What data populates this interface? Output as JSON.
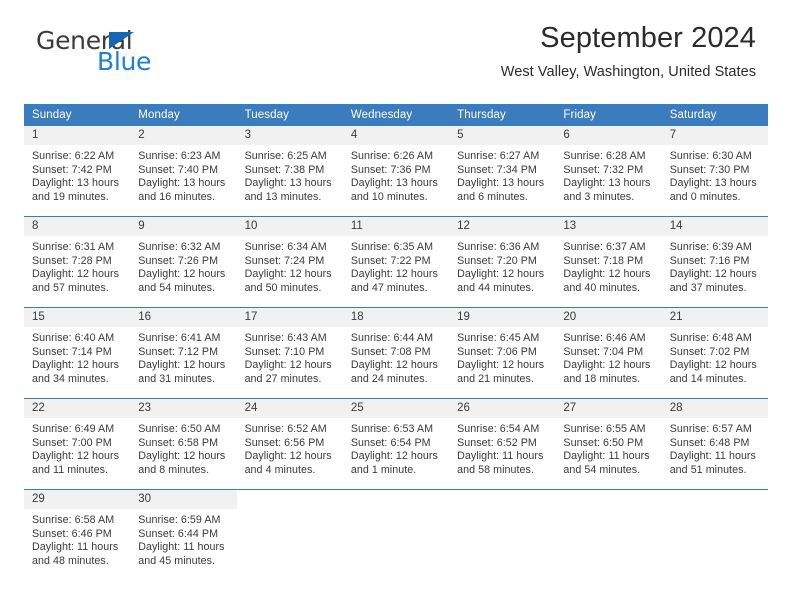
{
  "brand": {
    "word_top": "General",
    "word_bottom": "Blue",
    "triangle_icon": "blue-triangle-icon",
    "accent_color": "#1e7fd4"
  },
  "header": {
    "title": "September 2024",
    "subtitle": "West Valley, Washington, United States"
  },
  "theme": {
    "header_row_bg": "#3b7cbf",
    "daynum_bg": "#f1f1f1",
    "separator": "#3b7cbf",
    "text": "#3a3a3a"
  },
  "calendar": {
    "weekday_headers": [
      "Sunday",
      "Monday",
      "Tuesday",
      "Wednesday",
      "Thursday",
      "Friday",
      "Saturday"
    ],
    "weeks": [
      [
        {
          "day": "1",
          "sunrise": "Sunrise: 6:22 AM",
          "sunset": "Sunset: 7:42 PM",
          "daylight1": "Daylight: 13 hours",
          "daylight2": "and 19 minutes."
        },
        {
          "day": "2",
          "sunrise": "Sunrise: 6:23 AM",
          "sunset": "Sunset: 7:40 PM",
          "daylight1": "Daylight: 13 hours",
          "daylight2": "and 16 minutes."
        },
        {
          "day": "3",
          "sunrise": "Sunrise: 6:25 AM",
          "sunset": "Sunset: 7:38 PM",
          "daylight1": "Daylight: 13 hours",
          "daylight2": "and 13 minutes."
        },
        {
          "day": "4",
          "sunrise": "Sunrise: 6:26 AM",
          "sunset": "Sunset: 7:36 PM",
          "daylight1": "Daylight: 13 hours",
          "daylight2": "and 10 minutes."
        },
        {
          "day": "5",
          "sunrise": "Sunrise: 6:27 AM",
          "sunset": "Sunset: 7:34 PM",
          "daylight1": "Daylight: 13 hours",
          "daylight2": "and 6 minutes."
        },
        {
          "day": "6",
          "sunrise": "Sunrise: 6:28 AM",
          "sunset": "Sunset: 7:32 PM",
          "daylight1": "Daylight: 13 hours",
          "daylight2": "and 3 minutes."
        },
        {
          "day": "7",
          "sunrise": "Sunrise: 6:30 AM",
          "sunset": "Sunset: 7:30 PM",
          "daylight1": "Daylight: 13 hours",
          "daylight2": "and 0 minutes."
        }
      ],
      [
        {
          "day": "8",
          "sunrise": "Sunrise: 6:31 AM",
          "sunset": "Sunset: 7:28 PM",
          "daylight1": "Daylight: 12 hours",
          "daylight2": "and 57 minutes."
        },
        {
          "day": "9",
          "sunrise": "Sunrise: 6:32 AM",
          "sunset": "Sunset: 7:26 PM",
          "daylight1": "Daylight: 12 hours",
          "daylight2": "and 54 minutes."
        },
        {
          "day": "10",
          "sunrise": "Sunrise: 6:34 AM",
          "sunset": "Sunset: 7:24 PM",
          "daylight1": "Daylight: 12 hours",
          "daylight2": "and 50 minutes."
        },
        {
          "day": "11",
          "sunrise": "Sunrise: 6:35 AM",
          "sunset": "Sunset: 7:22 PM",
          "daylight1": "Daylight: 12 hours",
          "daylight2": "and 47 minutes."
        },
        {
          "day": "12",
          "sunrise": "Sunrise: 6:36 AM",
          "sunset": "Sunset: 7:20 PM",
          "daylight1": "Daylight: 12 hours",
          "daylight2": "and 44 minutes."
        },
        {
          "day": "13",
          "sunrise": "Sunrise: 6:37 AM",
          "sunset": "Sunset: 7:18 PM",
          "daylight1": "Daylight: 12 hours",
          "daylight2": "and 40 minutes."
        },
        {
          "day": "14",
          "sunrise": "Sunrise: 6:39 AM",
          "sunset": "Sunset: 7:16 PM",
          "daylight1": "Daylight: 12 hours",
          "daylight2": "and 37 minutes."
        }
      ],
      [
        {
          "day": "15",
          "sunrise": "Sunrise: 6:40 AM",
          "sunset": "Sunset: 7:14 PM",
          "daylight1": "Daylight: 12 hours",
          "daylight2": "and 34 minutes."
        },
        {
          "day": "16",
          "sunrise": "Sunrise: 6:41 AM",
          "sunset": "Sunset: 7:12 PM",
          "daylight1": "Daylight: 12 hours",
          "daylight2": "and 31 minutes."
        },
        {
          "day": "17",
          "sunrise": "Sunrise: 6:43 AM",
          "sunset": "Sunset: 7:10 PM",
          "daylight1": "Daylight: 12 hours",
          "daylight2": "and 27 minutes."
        },
        {
          "day": "18",
          "sunrise": "Sunrise: 6:44 AM",
          "sunset": "Sunset: 7:08 PM",
          "daylight1": "Daylight: 12 hours",
          "daylight2": "and 24 minutes."
        },
        {
          "day": "19",
          "sunrise": "Sunrise: 6:45 AM",
          "sunset": "Sunset: 7:06 PM",
          "daylight1": "Daylight: 12 hours",
          "daylight2": "and 21 minutes."
        },
        {
          "day": "20",
          "sunrise": "Sunrise: 6:46 AM",
          "sunset": "Sunset: 7:04 PM",
          "daylight1": "Daylight: 12 hours",
          "daylight2": "and 18 minutes."
        },
        {
          "day": "21",
          "sunrise": "Sunrise: 6:48 AM",
          "sunset": "Sunset: 7:02 PM",
          "daylight1": "Daylight: 12 hours",
          "daylight2": "and 14 minutes."
        }
      ],
      [
        {
          "day": "22",
          "sunrise": "Sunrise: 6:49 AM",
          "sunset": "Sunset: 7:00 PM",
          "daylight1": "Daylight: 12 hours",
          "daylight2": "and 11 minutes."
        },
        {
          "day": "23",
          "sunrise": "Sunrise: 6:50 AM",
          "sunset": "Sunset: 6:58 PM",
          "daylight1": "Daylight: 12 hours",
          "daylight2": "and 8 minutes."
        },
        {
          "day": "24",
          "sunrise": "Sunrise: 6:52 AM",
          "sunset": "Sunset: 6:56 PM",
          "daylight1": "Daylight: 12 hours",
          "daylight2": "and 4 minutes."
        },
        {
          "day": "25",
          "sunrise": "Sunrise: 6:53 AM",
          "sunset": "Sunset: 6:54 PM",
          "daylight1": "Daylight: 12 hours",
          "daylight2": "and 1 minute."
        },
        {
          "day": "26",
          "sunrise": "Sunrise: 6:54 AM",
          "sunset": "Sunset: 6:52 PM",
          "daylight1": "Daylight: 11 hours",
          "daylight2": "and 58 minutes."
        },
        {
          "day": "27",
          "sunrise": "Sunrise: 6:55 AM",
          "sunset": "Sunset: 6:50 PM",
          "daylight1": "Daylight: 11 hours",
          "daylight2": "and 54 minutes."
        },
        {
          "day": "28",
          "sunrise": "Sunrise: 6:57 AM",
          "sunset": "Sunset: 6:48 PM",
          "daylight1": "Daylight: 11 hours",
          "daylight2": "and 51 minutes."
        }
      ],
      [
        {
          "day": "29",
          "sunrise": "Sunrise: 6:58 AM",
          "sunset": "Sunset: 6:46 PM",
          "daylight1": "Daylight: 11 hours",
          "daylight2": "and 48 minutes."
        },
        {
          "day": "30",
          "sunrise": "Sunrise: 6:59 AM",
          "sunset": "Sunset: 6:44 PM",
          "daylight1": "Daylight: 11 hours",
          "daylight2": "and 45 minutes."
        },
        {
          "day": "",
          "sunrise": "",
          "sunset": "",
          "daylight1": "",
          "daylight2": ""
        },
        {
          "day": "",
          "sunrise": "",
          "sunset": "",
          "daylight1": "",
          "daylight2": ""
        },
        {
          "day": "",
          "sunrise": "",
          "sunset": "",
          "daylight1": "",
          "daylight2": ""
        },
        {
          "day": "",
          "sunrise": "",
          "sunset": "",
          "daylight1": "",
          "daylight2": ""
        },
        {
          "day": "",
          "sunrise": "",
          "sunset": "",
          "daylight1": "",
          "daylight2": ""
        }
      ]
    ]
  }
}
